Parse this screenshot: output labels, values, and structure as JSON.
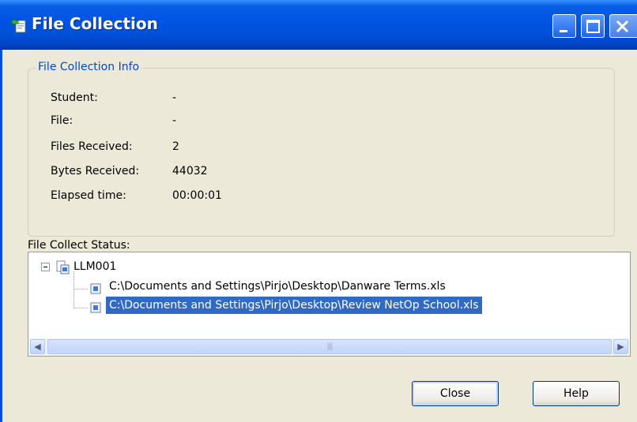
{
  "window": {
    "title": "File Collection",
    "title_icon": "file-collection-icon",
    "colors": {
      "titlebar": "#0054e3",
      "selection": "#316ac5",
      "group_label": "#0046d5"
    }
  },
  "info": {
    "group_label": "File Collection Info",
    "rows": [
      {
        "label": "Student:",
        "value": "-"
      },
      {
        "label": "File:",
        "value": "-"
      },
      {
        "label": "Files Received:",
        "value": "2"
      },
      {
        "label": "Bytes Received:",
        "value": "44032"
      },
      {
        "label": "Elapsed time:",
        "value": "00:00:01"
      }
    ]
  },
  "status": {
    "label": "File Collect Status:",
    "tree": {
      "root": {
        "label": "LLM001",
        "expanded": true
      },
      "children": [
        {
          "label": "C:\\Documents and Settings\\Pirjo\\Desktop\\Danware Terms.xls",
          "selected": false
        },
        {
          "label": "C:\\Documents and Settings\\Pirjo\\Desktop\\Review NetOp School.xls",
          "selected": true
        }
      ]
    }
  },
  "buttons": {
    "close": "Close",
    "help": "Help"
  }
}
